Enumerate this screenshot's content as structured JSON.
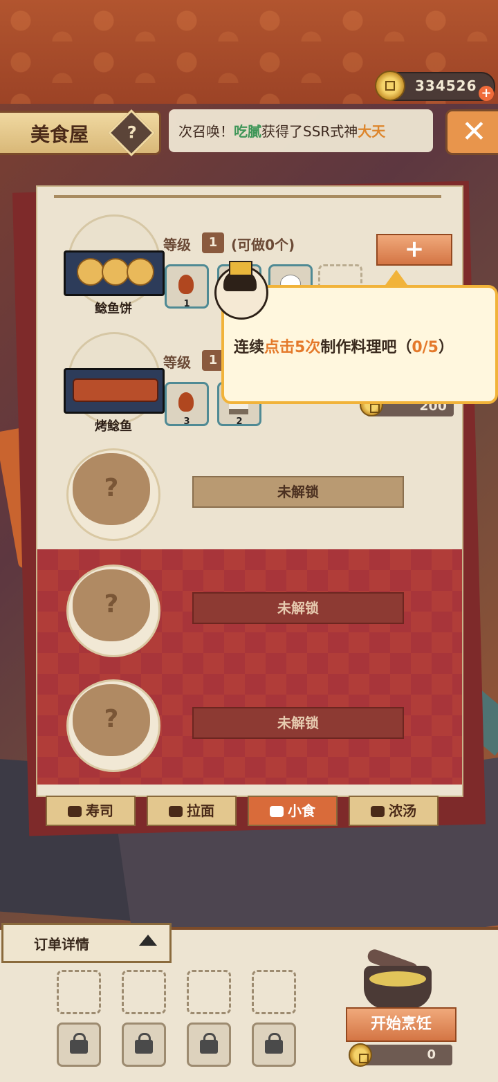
{
  "header": {
    "currency_value": "334526",
    "plus_label": "+",
    "title": "美食屋",
    "help_label": "?",
    "close_label": "✕",
    "notice": {
      "part1": "次召唤！",
      "name": "吃膩",
      "part2": "获得了SSR式神",
      "reward": "大天"
    }
  },
  "recipes": [
    {
      "name": "鲶鱼饼",
      "level_label": "等级",
      "level": "1",
      "can_make": "(可做0个)",
      "ingredients": [
        {
          "icon": "shrimp-icon",
          "count": "1"
        },
        {
          "icon": "rice-icon",
          "count": ""
        },
        {
          "icon": "egg-icon",
          "count": ""
        },
        {
          "icon": "",
          "count": ""
        }
      ],
      "add_label": "+"
    },
    {
      "name": "烤鲶鱼",
      "level_label": "等级",
      "level": "1",
      "ingredients": [
        {
          "icon": "shrimp-icon",
          "count": "3"
        },
        {
          "icon": "rice-icon",
          "count": "2"
        }
      ],
      "price": "200"
    }
  ],
  "locked_label": "未解锁",
  "locked_q": "?",
  "categories": [
    {
      "label": "寿司",
      "active": false
    },
    {
      "label": "拉面",
      "active": false
    },
    {
      "label": "小食",
      "active": true
    },
    {
      "label": "浓汤",
      "active": false
    }
  ],
  "tooltip": {
    "prefix": "连续",
    "highlight": "点击5次",
    "suffix": "制作料理吧（",
    "progress": "0/5",
    "close": "）"
  },
  "order": {
    "label": "订单详情",
    "cook_label": "开始烹饪",
    "cost": "0"
  },
  "colors": {
    "accent": "#d96b3a",
    "tooltip_border": "#f1b33a",
    "highlight": "#e4792a",
    "notice_green": "#3d9b5a"
  }
}
